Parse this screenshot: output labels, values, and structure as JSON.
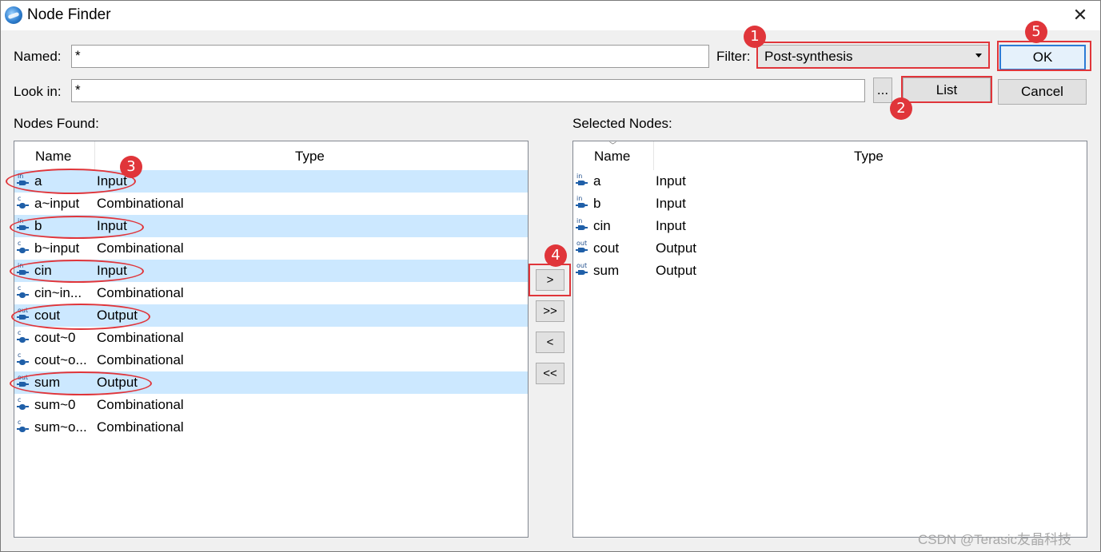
{
  "window": {
    "title": "Node Finder",
    "close_glyph": "✕",
    "app_icon": "quartus-globe-icon"
  },
  "search": {
    "named_label": "Named:",
    "named_value": "*",
    "lookin_label": "Look in:",
    "lookin_value": "*",
    "browse_label": "...",
    "filter_label": "Filter:",
    "filter_value": "Post-synthesis"
  },
  "buttons": {
    "ok": "OK",
    "list": "List",
    "cancel": "Cancel"
  },
  "found": {
    "title": "Nodes Found:",
    "col_name": "Name",
    "col_type": "Type",
    "rows": [
      {
        "name": "a",
        "type": "Input",
        "icon": "in",
        "selected": true
      },
      {
        "name": "a~input",
        "type": "Combinational",
        "icon": "c",
        "selected": false
      },
      {
        "name": "b",
        "type": "Input",
        "icon": "in",
        "selected": true
      },
      {
        "name": "b~input",
        "type": "Combinational",
        "icon": "c",
        "selected": false
      },
      {
        "name": "cin",
        "type": "Input",
        "icon": "in",
        "selected": true
      },
      {
        "name": "cin~in...",
        "type": "Combinational",
        "icon": "c",
        "selected": false
      },
      {
        "name": "cout",
        "type": "Output",
        "icon": "out",
        "selected": true
      },
      {
        "name": "cout~0",
        "type": "Combinational",
        "icon": "c",
        "selected": false
      },
      {
        "name": "cout~o...",
        "type": "Combinational",
        "icon": "c",
        "selected": false
      },
      {
        "name": "sum",
        "type": "Output",
        "icon": "out",
        "selected": true
      },
      {
        "name": "sum~0",
        "type": "Combinational",
        "icon": "c",
        "selected": false
      },
      {
        "name": "sum~o...",
        "type": "Combinational",
        "icon": "c",
        "selected": false
      }
    ]
  },
  "transfer": {
    "add": ">",
    "add_all": ">>",
    "remove": "<",
    "remove_all": "<<"
  },
  "selected": {
    "title": "Selected Nodes:",
    "col_name": "Name",
    "col_type": "Type",
    "rows": [
      {
        "name": "a",
        "type": "Input",
        "icon": "in"
      },
      {
        "name": "b",
        "type": "Input",
        "icon": "in"
      },
      {
        "name": "cin",
        "type": "Input",
        "icon": "in"
      },
      {
        "name": "cout",
        "type": "Output",
        "icon": "out"
      },
      {
        "name": "sum",
        "type": "Output",
        "icon": "out"
      }
    ]
  },
  "annotations": {
    "badges": [
      "1",
      "2",
      "3",
      "4",
      "5"
    ],
    "color": "#e0353a"
  },
  "watermark": "CSDN @Terasic友晶科技",
  "colors": {
    "selection": "#cce8ff",
    "default_button_border": "#2b7bd6"
  }
}
